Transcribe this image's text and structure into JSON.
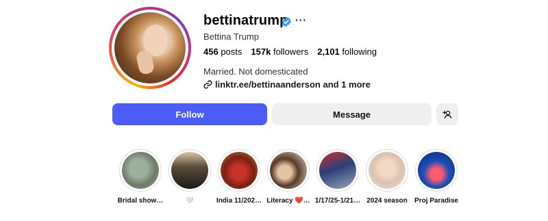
{
  "profile": {
    "username": "bettinatrump",
    "full_name": "Bettina Trump",
    "more_label": "···",
    "stats": {
      "posts": "456",
      "posts_label": "posts",
      "followers": "157k",
      "followers_label": "followers",
      "following": "2,101",
      "following_label": "following"
    },
    "bio": "Married. Not domesticated",
    "link": "linktr.ee/bettinaanderson and 1 more"
  },
  "actions": {
    "follow_label": "Follow",
    "message_label": "Message"
  },
  "highlights": [
    {
      "label": "Bridal show…"
    },
    {
      "label": "🤍"
    },
    {
      "label": "India 11/202…"
    },
    {
      "label": "Literacy ❤️…"
    },
    {
      "label": "1/17/25-1/21…"
    },
    {
      "label": "2024 season"
    },
    {
      "label": "Proj Paradise"
    }
  ],
  "colors": {
    "accent": "#4a5df9",
    "verified": "#3897f0",
    "button_gray": "#efefef"
  },
  "icons": [
    "verified-badge-icon",
    "more-options-icon",
    "link-icon",
    "add-user-icon"
  ]
}
